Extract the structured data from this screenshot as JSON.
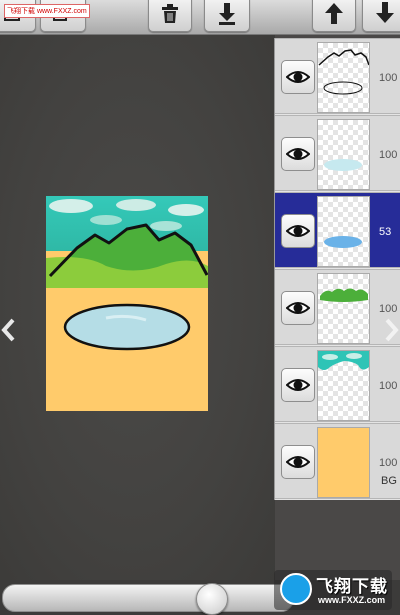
{
  "watermark_top": "飞翔下载 www.FXXZ.com",
  "toolbar": {
    "buttons": [
      {
        "name": "layer-add-button",
        "icon": "new-layer-icon"
      },
      {
        "name": "layer-copy-button",
        "icon": "copy-layer-icon"
      },
      {
        "name": "delete-layer-button",
        "icon": "trash-icon"
      },
      {
        "name": "merge-down-button",
        "icon": "arrow-down-bar-icon"
      },
      {
        "name": "move-layer-up-button",
        "icon": "arrow-up-icon"
      },
      {
        "name": "move-layer-down-button",
        "icon": "arrow-down-icon"
      }
    ]
  },
  "layers": [
    {
      "opacity": "100",
      "name": "",
      "selected": false,
      "visible": true
    },
    {
      "opacity": "100",
      "name": "",
      "selected": false,
      "visible": true
    },
    {
      "opacity": "53",
      "name": "",
      "selected": true,
      "visible": true
    },
    {
      "opacity": "100",
      "name": "",
      "selected": false,
      "visible": true
    },
    {
      "opacity": "100",
      "name": "",
      "selected": false,
      "visible": true
    },
    {
      "opacity": "100",
      "name": "BG",
      "selected": false,
      "visible": true
    }
  ],
  "colors": {
    "selected_layer": "#262c98",
    "background_layer_fill": "#ffcb6b",
    "water": "#b5dde6",
    "grass": "#4caf3a",
    "sky_teal": "#2ec4b6"
  },
  "bottom_watermark": {
    "title": "飞翔下载",
    "url": "www.FXXZ.com"
  }
}
